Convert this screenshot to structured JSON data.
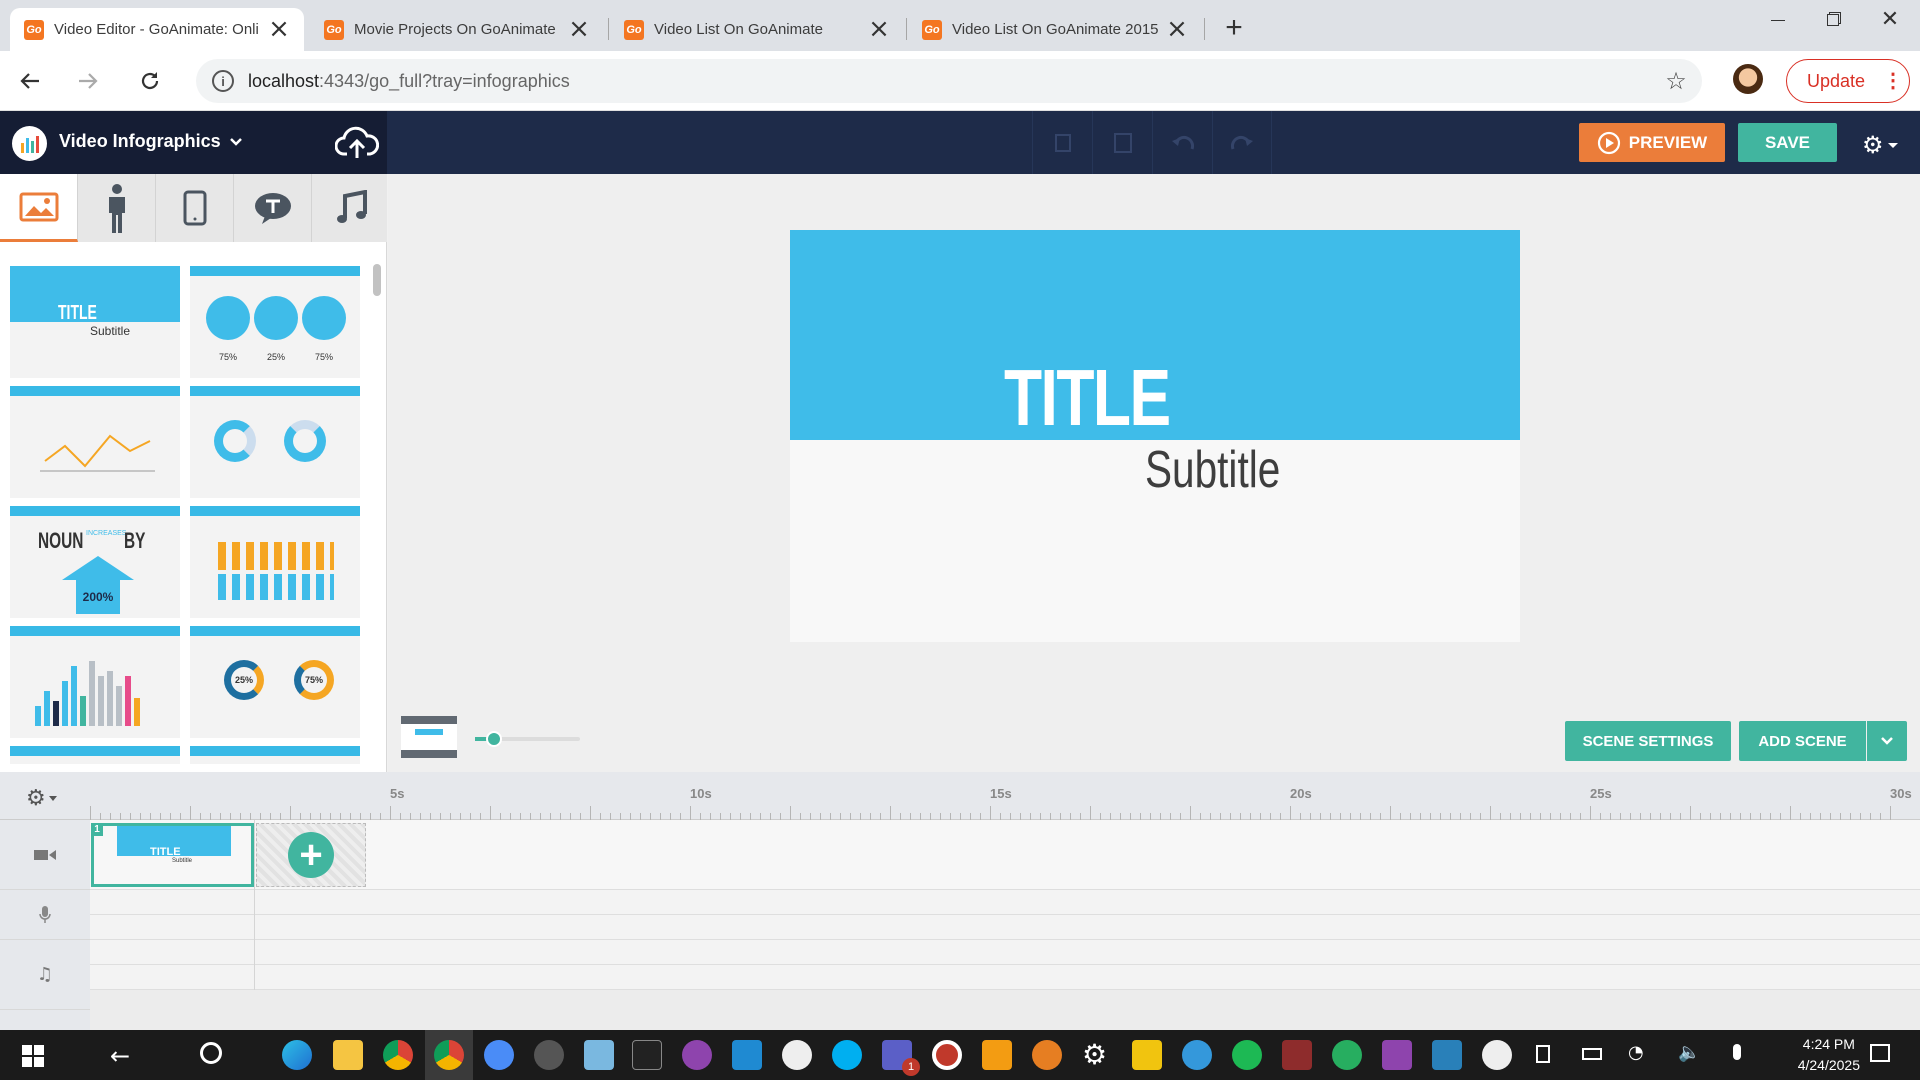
{
  "browser": {
    "tabs": [
      {
        "title": "Video Editor - GoAnimate: Onli",
        "active": true
      },
      {
        "title": "Movie Projects On GoAnimate",
        "active": false
      },
      {
        "title": "Video List On GoAnimate",
        "active": false
      },
      {
        "title": "Video List On GoAnimate 2015",
        "active": false
      }
    ],
    "favicon_text": "Go",
    "new_tab": "+",
    "url_host": "localhost",
    "url_rest": ":4343/go_full?tray=infographics",
    "update_label": "Update"
  },
  "app": {
    "theme_name": "Video Infographics",
    "preview_label": "PREVIEW",
    "save_label": "SAVE"
  },
  "tray": {
    "thumb1": {
      "title": "TITLE",
      "subtitle": "Subtitle"
    },
    "thumb2": {
      "labels": [
        "75%",
        "25%",
        "75%"
      ]
    },
    "thumb5": {
      "noun": "NOUN",
      "increases": "INCREASES",
      "by": "BY",
      "pct": "200%"
    },
    "thumb8": {
      "labels": [
        "25%",
        "75%"
      ]
    },
    "mini_title": "Title",
    "mini_sub": "Subtitle"
  },
  "stage": {
    "title": "TITLE",
    "subtitle": "Subtitle",
    "scene_settings_label": "SCENE SETTINGS",
    "add_scene_label": "ADD SCENE"
  },
  "timeline": {
    "ticks": [
      "5s",
      "10s",
      "15s",
      "20s",
      "25s",
      "30s"
    ],
    "scene_number": "1",
    "scene_thumb_title": "TITLE",
    "scene_thumb_subtitle": "Subtitle"
  },
  "taskbar": {
    "time": "4:24 PM",
    "date": "4/24/2025",
    "badge": "1"
  },
  "colors": {
    "accent_orange": "#eb7d3a",
    "accent_green": "#41b59f",
    "slide_blue": "#3fbce9",
    "header_navy": "#1e2b49"
  }
}
